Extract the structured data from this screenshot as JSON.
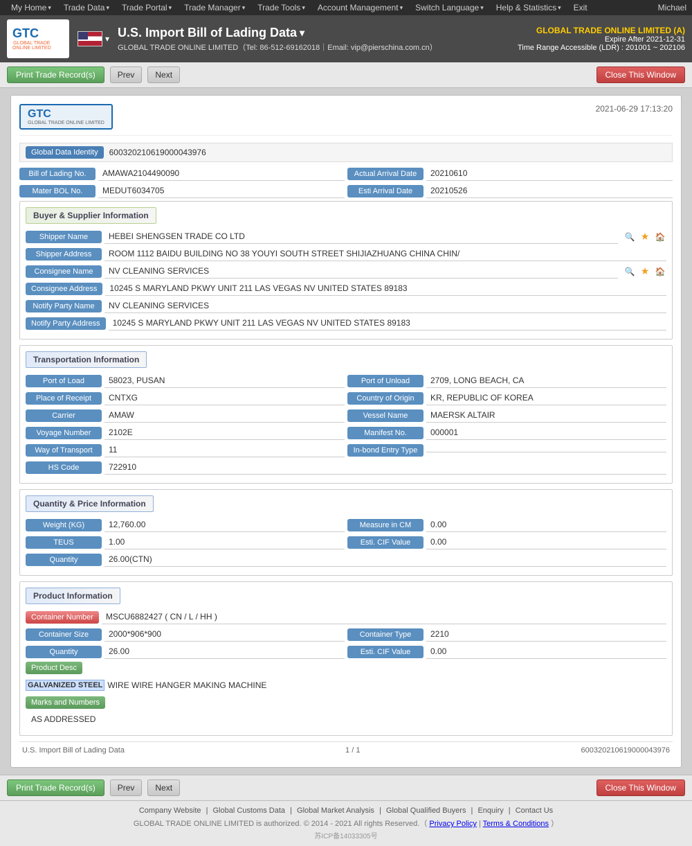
{
  "nav": {
    "items": [
      {
        "label": "My Home",
        "hasArrow": true
      },
      {
        "label": "Trade Data",
        "hasArrow": true
      },
      {
        "label": "Trade Portal",
        "hasArrow": true
      },
      {
        "label": "Trade Manager",
        "hasArrow": true
      },
      {
        "label": "Trade Tools",
        "hasArrow": true
      },
      {
        "label": "Account Management",
        "hasArrow": true
      },
      {
        "label": "Switch Language",
        "hasArrow": true
      },
      {
        "label": "Help & Statistics",
        "hasArrow": true
      },
      {
        "label": "Exit",
        "hasArrow": false
      }
    ],
    "user": "Michael"
  },
  "header": {
    "title": "U.S. Import Bill of Lading Data",
    "subtitle": "GLOBAL TRADE ONLINE LIMITED（Tel: 86-512-69162018｜Email: vip@pierschina.com.cn）",
    "company": "GLOBAL TRADE ONLINE LIMITED (A)",
    "expire": "Expire After 2021-12-31",
    "timerange": "Time Range Accessible (LDR) : 201001 ~ 202106"
  },
  "toolbar": {
    "print_label": "Print Trade Record(s)",
    "prev_label": "Prev",
    "next_label": "Next",
    "close_label": "Close This Window"
  },
  "document": {
    "timestamp": "2021-06-29 17:13:20",
    "global_data_identity_label": "Global Data Identity",
    "global_data_identity_value": "600320210619000043976",
    "bill_of_lading_label": "Bill of Lading No.",
    "bill_of_lading_value": "AMAWA2104490090",
    "actual_arrival_date_label": "Actual Arrival Date",
    "actual_arrival_date_value": "20210610",
    "mater_bol_label": "Mater BOL No.",
    "mater_bol_value": "MEDUT6034705",
    "esti_arrival_date_label": "Esti Arrival Date",
    "esti_arrival_date_value": "20210526",
    "buyer_supplier_section": "Buyer & Supplier Information",
    "shipper_name_label": "Shipper Name",
    "shipper_name_value": "HEBEI SHENGSEN TRADE CO LTD",
    "shipper_address_label": "Shipper Address",
    "shipper_address_value": "ROOM 1112 BAIDU BUILDING NO 38 YOUYI SOUTH STREET SHIJIAZHUANG CHINA CHIN/",
    "consignee_name_label": "Consignee Name",
    "consignee_name_value": "NV CLEANING SERVICES",
    "consignee_address_label": "Consignee Address",
    "consignee_address_value": "10245 S MARYLAND PKWY UNIT 211 LAS VEGAS NV UNITED STATES 89183",
    "notify_party_name_label": "Notify Party Name",
    "notify_party_name_value": "NV CLEANING SERVICES",
    "notify_party_address_label": "Notify Party Address",
    "notify_party_address_value": "10245 S MARYLAND PKWY UNIT 211 LAS VEGAS NV UNITED STATES 89183",
    "transport_section": "Transportation Information",
    "port_of_load_label": "Port of Load",
    "port_of_load_value": "58023, PUSAN",
    "port_of_unload_label": "Port of Unload",
    "port_of_unload_value": "2709, LONG BEACH, CA",
    "place_of_receipt_label": "Place of Receipt",
    "place_of_receipt_value": "CNTXG",
    "country_of_origin_label": "Country of Origin",
    "country_of_origin_value": "KR, REPUBLIC OF KOREA",
    "carrier_label": "Carrier",
    "carrier_value": "AMAW",
    "vessel_name_label": "Vessel Name",
    "vessel_name_value": "MAERSK ALTAIR",
    "voyage_number_label": "Voyage Number",
    "voyage_number_value": "2102E",
    "manifest_no_label": "Manifest No.",
    "manifest_no_value": "000001",
    "way_of_transport_label": "Way of Transport",
    "way_of_transport_value": "11",
    "inbond_entry_type_label": "In-bond Entry Type",
    "inbond_entry_type_value": "",
    "hs_code_label": "HS Code",
    "hs_code_value": "722910",
    "quantity_section": "Quantity & Price Information",
    "weight_label": "Weight (KG)",
    "weight_value": "12,760.00",
    "measure_in_cm_label": "Measure in CM",
    "measure_in_cm_value": "0.00",
    "teus_label": "TEUS",
    "teus_value": "1.00",
    "esti_cif_value_label": "Esti. CIF Value",
    "esti_cif_value_value": "0.00",
    "quantity_label": "Quantity",
    "quantity_value": "26.00(CTN)",
    "product_section": "Product Information",
    "container_number_label": "Container Number",
    "container_number_value": "MSCU6882427 ( CN / L / HH )",
    "container_size_label": "Container Size",
    "container_size_value": "2000*906*900",
    "container_type_label": "Container Type",
    "container_type_value": "2210",
    "prod_quantity_label": "Quantity",
    "prod_quantity_value": "26.00",
    "prod_esti_cif_label": "Esti. CIF Value",
    "prod_esti_cif_value": "0.00",
    "product_desc_label": "Product Desc",
    "product_desc_highlight": "GALVANIZED STEEL",
    "product_desc_rest": " WIRE WIRE HANGER MAKING MACHINE",
    "marks_label": "Marks and Numbers",
    "marks_value": "AS ADDRESSED",
    "doc_footer_left": "U.S. Import Bill of Lading Data",
    "doc_footer_page": "1 / 1",
    "doc_footer_id": "600320210619000043976"
  },
  "footer": {
    "icp": "苏ICP备14033305号",
    "links": [
      "Company Website",
      "Global Customs Data",
      "Global Market Analysis",
      "Global Qualified Buyers",
      "Enquiry",
      "Contact Us"
    ],
    "copyright": "GLOBAL TRADE ONLINE LIMITED is authorized. © 2014 - 2021 All rights Reserved.（",
    "privacy": "Privacy Policy",
    "terms": "Terms & Conditions",
    "copyright_end": "）"
  }
}
